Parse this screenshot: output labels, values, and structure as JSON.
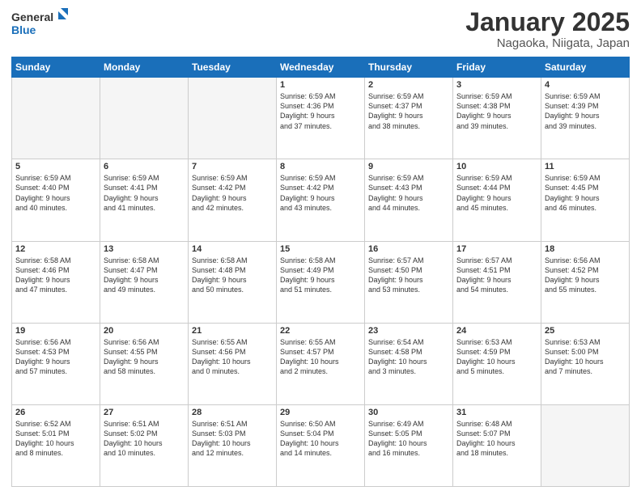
{
  "header": {
    "logo_line1": "General",
    "logo_line2": "Blue",
    "title": "January 2025",
    "subtitle": "Nagaoka, Niigata, Japan"
  },
  "weekdays": [
    "Sunday",
    "Monday",
    "Tuesday",
    "Wednesday",
    "Thursday",
    "Friday",
    "Saturday"
  ],
  "weeks": [
    [
      {
        "day": "",
        "info": ""
      },
      {
        "day": "",
        "info": ""
      },
      {
        "day": "",
        "info": ""
      },
      {
        "day": "1",
        "info": "Sunrise: 6:59 AM\nSunset: 4:36 PM\nDaylight: 9 hours\nand 37 minutes."
      },
      {
        "day": "2",
        "info": "Sunrise: 6:59 AM\nSunset: 4:37 PM\nDaylight: 9 hours\nand 38 minutes."
      },
      {
        "day": "3",
        "info": "Sunrise: 6:59 AM\nSunset: 4:38 PM\nDaylight: 9 hours\nand 39 minutes."
      },
      {
        "day": "4",
        "info": "Sunrise: 6:59 AM\nSunset: 4:39 PM\nDaylight: 9 hours\nand 39 minutes."
      }
    ],
    [
      {
        "day": "5",
        "info": "Sunrise: 6:59 AM\nSunset: 4:40 PM\nDaylight: 9 hours\nand 40 minutes."
      },
      {
        "day": "6",
        "info": "Sunrise: 6:59 AM\nSunset: 4:41 PM\nDaylight: 9 hours\nand 41 minutes."
      },
      {
        "day": "7",
        "info": "Sunrise: 6:59 AM\nSunset: 4:42 PM\nDaylight: 9 hours\nand 42 minutes."
      },
      {
        "day": "8",
        "info": "Sunrise: 6:59 AM\nSunset: 4:42 PM\nDaylight: 9 hours\nand 43 minutes."
      },
      {
        "day": "9",
        "info": "Sunrise: 6:59 AM\nSunset: 4:43 PM\nDaylight: 9 hours\nand 44 minutes."
      },
      {
        "day": "10",
        "info": "Sunrise: 6:59 AM\nSunset: 4:44 PM\nDaylight: 9 hours\nand 45 minutes."
      },
      {
        "day": "11",
        "info": "Sunrise: 6:59 AM\nSunset: 4:45 PM\nDaylight: 9 hours\nand 46 minutes."
      }
    ],
    [
      {
        "day": "12",
        "info": "Sunrise: 6:58 AM\nSunset: 4:46 PM\nDaylight: 9 hours\nand 47 minutes."
      },
      {
        "day": "13",
        "info": "Sunrise: 6:58 AM\nSunset: 4:47 PM\nDaylight: 9 hours\nand 49 minutes."
      },
      {
        "day": "14",
        "info": "Sunrise: 6:58 AM\nSunset: 4:48 PM\nDaylight: 9 hours\nand 50 minutes."
      },
      {
        "day": "15",
        "info": "Sunrise: 6:58 AM\nSunset: 4:49 PM\nDaylight: 9 hours\nand 51 minutes."
      },
      {
        "day": "16",
        "info": "Sunrise: 6:57 AM\nSunset: 4:50 PM\nDaylight: 9 hours\nand 53 minutes."
      },
      {
        "day": "17",
        "info": "Sunrise: 6:57 AM\nSunset: 4:51 PM\nDaylight: 9 hours\nand 54 minutes."
      },
      {
        "day": "18",
        "info": "Sunrise: 6:56 AM\nSunset: 4:52 PM\nDaylight: 9 hours\nand 55 minutes."
      }
    ],
    [
      {
        "day": "19",
        "info": "Sunrise: 6:56 AM\nSunset: 4:53 PM\nDaylight: 9 hours\nand 57 minutes."
      },
      {
        "day": "20",
        "info": "Sunrise: 6:56 AM\nSunset: 4:55 PM\nDaylight: 9 hours\nand 58 minutes."
      },
      {
        "day": "21",
        "info": "Sunrise: 6:55 AM\nSunset: 4:56 PM\nDaylight: 10 hours\nand 0 minutes."
      },
      {
        "day": "22",
        "info": "Sunrise: 6:55 AM\nSunset: 4:57 PM\nDaylight: 10 hours\nand 2 minutes."
      },
      {
        "day": "23",
        "info": "Sunrise: 6:54 AM\nSunset: 4:58 PM\nDaylight: 10 hours\nand 3 minutes."
      },
      {
        "day": "24",
        "info": "Sunrise: 6:53 AM\nSunset: 4:59 PM\nDaylight: 10 hours\nand 5 minutes."
      },
      {
        "day": "25",
        "info": "Sunrise: 6:53 AM\nSunset: 5:00 PM\nDaylight: 10 hours\nand 7 minutes."
      }
    ],
    [
      {
        "day": "26",
        "info": "Sunrise: 6:52 AM\nSunset: 5:01 PM\nDaylight: 10 hours\nand 8 minutes."
      },
      {
        "day": "27",
        "info": "Sunrise: 6:51 AM\nSunset: 5:02 PM\nDaylight: 10 hours\nand 10 minutes."
      },
      {
        "day": "28",
        "info": "Sunrise: 6:51 AM\nSunset: 5:03 PM\nDaylight: 10 hours\nand 12 minutes."
      },
      {
        "day": "29",
        "info": "Sunrise: 6:50 AM\nSunset: 5:04 PM\nDaylight: 10 hours\nand 14 minutes."
      },
      {
        "day": "30",
        "info": "Sunrise: 6:49 AM\nSunset: 5:05 PM\nDaylight: 10 hours\nand 16 minutes."
      },
      {
        "day": "31",
        "info": "Sunrise: 6:48 AM\nSunset: 5:07 PM\nDaylight: 10 hours\nand 18 minutes."
      },
      {
        "day": "",
        "info": ""
      }
    ]
  ]
}
